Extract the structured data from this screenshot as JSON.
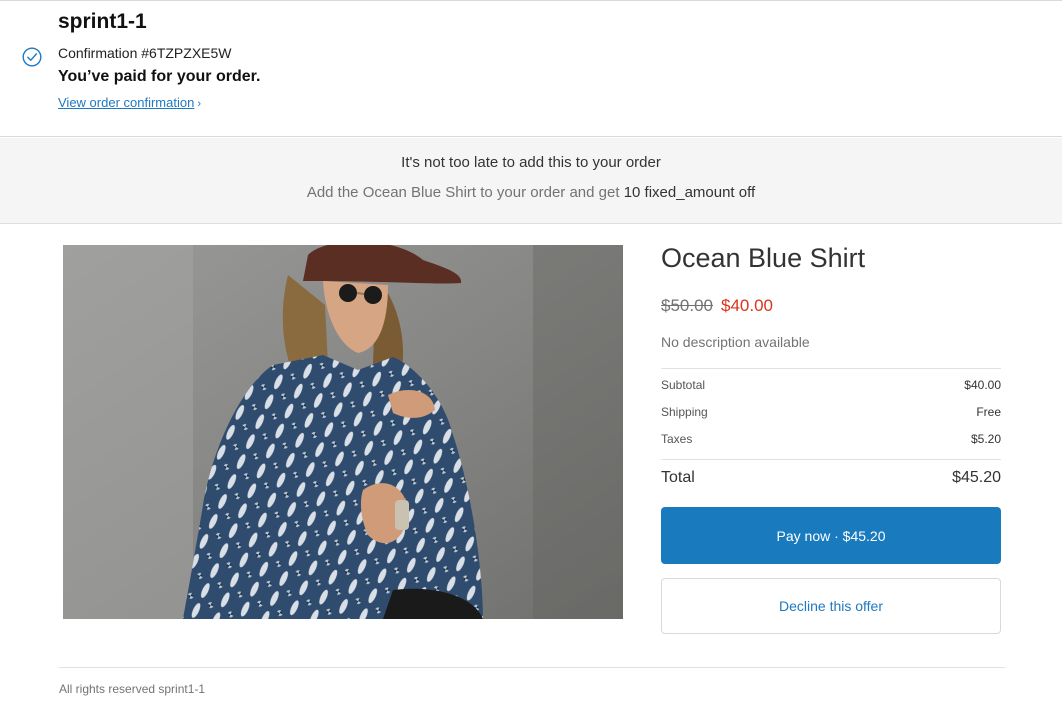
{
  "header": {
    "shop_name": "sprint1-1",
    "confirmation": "Confirmation #6TZPZXE5W",
    "paid_message": "You’ve paid for your order.",
    "view_link": "View order confirmation",
    "view_link_chevron": "›"
  },
  "banner": {
    "title": "It's not too late to add this to your order",
    "sub_prefix": "Add the Ocean Blue Shirt to your order and get ",
    "sub_emphasis": "10 fixed_amount off"
  },
  "product": {
    "title": "Ocean Blue Shirt",
    "price_original": "$50.00",
    "price_sale": "$40.00",
    "description": "No description available"
  },
  "summary": {
    "subtotal_label": "Subtotal",
    "subtotal_value": "$40.00",
    "shipping_label": "Shipping",
    "shipping_value": "Free",
    "taxes_label": "Taxes",
    "taxes_value": "$5.20",
    "total_label": "Total",
    "total_value": "$45.20"
  },
  "actions": {
    "pay_now": "Pay now · $45.20",
    "decline": "Decline this offer"
  },
  "footer": {
    "text": "All rights reserved sprint1-1"
  },
  "colors": {
    "accent": "#197bbd",
    "link": "#1f78c1",
    "sale_price": "#d9341c",
    "banner_bg": "#f5f5f5"
  }
}
